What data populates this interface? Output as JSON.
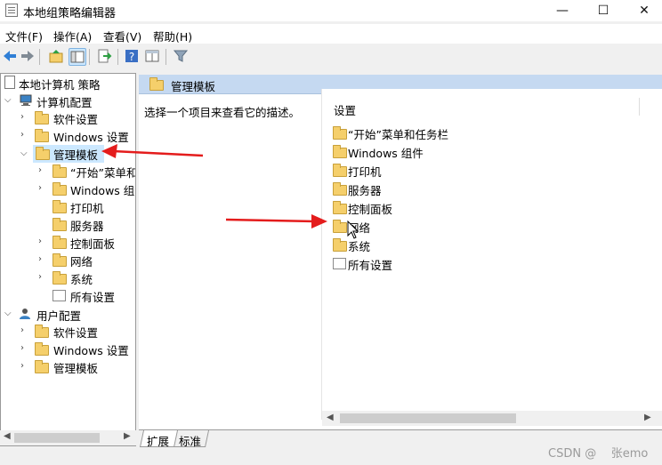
{
  "window": {
    "title": "本地组策略编辑器",
    "controls": {
      "minimize": "—",
      "maximize": "☐",
      "close": "✕"
    }
  },
  "menubar": {
    "items": [
      "文件(F)",
      "操作(A)",
      "查看(V)",
      "帮助(H)"
    ]
  },
  "toolbar": {
    "icons": [
      "back-arrow-icon",
      "forward-arrow-icon",
      "up-folder-icon",
      "show-hide-tree-icon",
      "export-list-icon",
      "help-icon",
      "extended-view-icon",
      "filter-icon"
    ]
  },
  "tree": {
    "root": "本地计算机 策略",
    "computer_config": "计算机配置",
    "computer_children": {
      "software": "软件设置",
      "windows": "Windows 设置",
      "admin": "管理模板"
    },
    "admin_children": [
      "“开始”菜单和",
      "Windows 组",
      "打印机",
      "服务器",
      "控制面板",
      "网络",
      "系统",
      "所有设置"
    ],
    "user_config": "用户配置",
    "user_children": [
      "软件设置",
      "Windows 设置",
      "管理模板"
    ]
  },
  "right": {
    "header_title": "管理模板",
    "description": "选择一个项目来查看它的描述。",
    "column_header": "设置",
    "items": [
      "“开始”菜单和任务栏",
      "Windows 组件",
      "打印机",
      "服务器",
      "控制面板",
      "网络",
      "系统",
      "所有设置"
    ]
  },
  "tabs": [
    "扩展",
    "标准"
  ],
  "watermark": "CSDN @    张emo",
  "colors": {
    "selection": "#cce8ff",
    "header_band": "#c5d9f1",
    "annotation_arrow": "#e41c1c",
    "folder": "#f5cf6b"
  }
}
